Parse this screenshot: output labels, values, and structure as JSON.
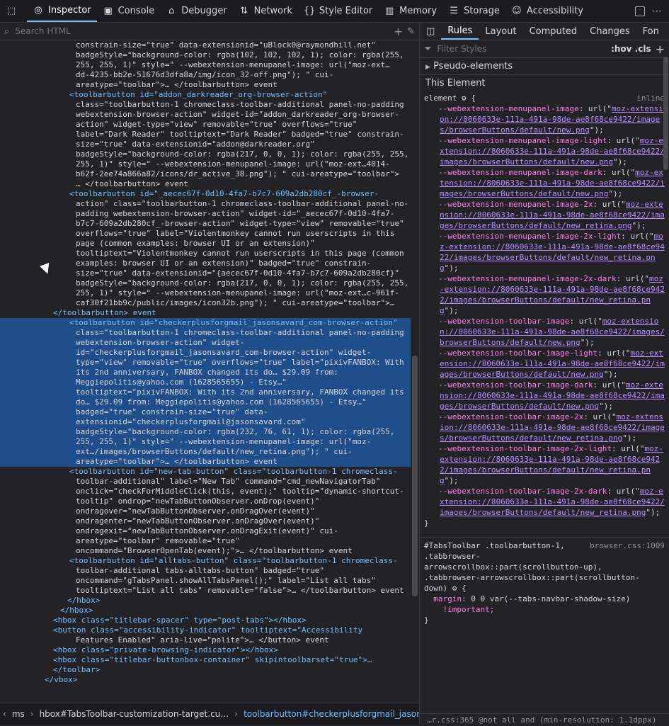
{
  "toolbar": {
    "tabs": [
      {
        "label": "Inspector",
        "icon": "inspector-icon"
      },
      {
        "label": "Console",
        "icon": "console-icon"
      },
      {
        "label": "Debugger",
        "icon": "debugger-icon"
      },
      {
        "label": "Network",
        "icon": "network-icon"
      },
      {
        "label": "Style Editor",
        "icon": "style-editor-icon"
      },
      {
        "label": "Memory",
        "icon": "memory-icon"
      },
      {
        "label": "Storage",
        "icon": "storage-icon"
      },
      {
        "label": "Accessibility",
        "icon": "accessibility-icon"
      }
    ]
  },
  "search": {
    "placeholder": "Search HTML"
  },
  "tree": {
    "lines": [
      "constrain-size=\"true\" data-extensionid=\"uBlock0@raymondhill.net\"",
      "badgeStyle=\"background-color: rgba(102, 102, 102, 1); color: rgba(255,",
      "255, 255, 1)\" style=\" --webextension-menupanel-image: url(\"moz-ext…",
      "dd-4235-bb2e-51676d3dfa8a/img/icon_32-off.png\"); \" cui-",
      "areatype=\"toolbar\">… </toolbarbutton> event",
      "<toolbarbutton id=\"addon_darkreader_org-browser-action\"",
      "class=\"toolbarbutton-1 chromeclass-toolbar-additional panel-no-padding",
      "webextension-browser-action\" widget-id=\"addon_darkreader_org-browser-",
      "action\" widget-type=\"view\" removable=\"true\" overflows=\"true\"",
      "label=\"Dark Reader\" tooltiptext=\"Dark Reader\" badged=\"true\" constrain-",
      "size=\"true\" data-extensionid=\"addon@darkreader.org\"",
      "badgeStyle=\"background-color: rgba(217, 0, 0, 1); color: rgba(255, 255,",
      "255, 1)\" style=\" --webextension-menupanel-image: url(\"moz-ext…4014-",
      "b62f-2ee74a866a82/icons/dr_active_38.png\"); \" cui-areatype=\"toolbar\">",
      "… </toolbarbutton> event",
      "<toolbarbutton id=\"_aecec67f-0d10-4fa7-b7c7-609a2db280cf_-browser-",
      "action\" class=\"toolbarbutton-1 chromeclass-toolbar-additional panel-no-",
      "padding webextension-browser-action\" widget-id=\"_aecec67f-0d10-4fa7-",
      "b7c7-609a2db280cf_-browser-action\" widget-type=\"view\" removable=\"true\"",
      "overflows=\"true\" label=\"Violentmonkey cannot run userscripts in this",
      "page (common examples: browser UI or an extension)\"",
      "tooltiptext=\"Violentmonkey cannot run userscripts in this page (common",
      "examples: browser UI or an extension)\" badged=\"true\" constrain-",
      "size=\"true\" data-extensionid=\"{aecec67f-0d10-4fa7-b7c7-609a2db280cf}\"",
      "badgeStyle=\"background-color: rgba(217, 0, 0, 1); color: rgba(255, 255,",
      "255, 1)\" style=\" --webextension-menupanel-image: url(\"moz-ext…c-961f-",
      "caf30f21bb9c/public/images/icon32b.png\"); \" cui-areatype=\"toolbar\">…",
      "</toolbarbutton> event"
    ],
    "selected_lines": [
      "<toolbarbutton id=\"checkerplusforgmail_jasonsavard_com-browser-action\"",
      "class=\"toolbarbutton-1 chromeclass-toolbar-additional panel-no-padding",
      "webextension-browser-action\" widget-",
      "id=\"checkerplusforgmail_jasonsavard_com-browser-action\" widget-",
      "type=\"view\" removable=\"true\" overflows=\"true\" label=\"pixivFANBOX: With",
      "its 2nd anniversary, FANBOX changed its do… $29.09 from:",
      "Meggiepolitis@yahoo.com (1628565655) - Etsy…\"",
      "tooltiptext=\"pixivFANBOX: With its 2nd anniversary, FANBOX changed its",
      "do… $29.09 from: Meggiepolitis@yahoo.com (1628565655) - Etsy…\"",
      "badged=\"true\" constrain-size=\"true\" data-",
      "extensionid=\"checkerplusforgmail@jasonsavard.com\"",
      "badgeStyle=\"background-color: rgba(232, 76, 61, 1); color: rgba(255,",
      "255, 255, 1)\" style=\" --webextension-menupanel-image: url(\"moz-",
      "ext…/images/browserButtons/default/new_retina.png\"); \" cui-",
      "areatype=\"toolbar\">… </toolbarbutton> event"
    ],
    "after_lines": [
      "<toolbarbutton id=\"new-tab-button\" class=\"toolbarbutton-1 chromeclass-",
      "toolbar-additional\" label=\"New Tab\" command=\"cmd_newNavigatorTab\"",
      "onclick=\"checkForMiddleClick(this, event);\" tooltip=\"dynamic-shortcut-",
      "tooltip\" ondrop=\"newTabButtonObserver.onDrop(event)\"",
      "ondragover=\"newTabButtonObserver.onDragOver(event)\"",
      "ondragenter=\"newTabButtonObserver.onDragOver(event)\"",
      "ondragexit=\"newTabButtonObserver.onDragExit(event)\" cui-",
      "areatype=\"toolbar\" removable=\"true\"",
      "oncommand=\"BrowserOpenTab(event);\">… </toolbarbutton> event",
      "<toolbarbutton id=\"alltabs-button\" class=\"toolbarbutton-1 chromeclass-",
      "toolbar-additional tabs-alltabs-button\" badged=\"true\"",
      "oncommand=\"gTabsPanel.showAllTabsPanel();\" label=\"List all tabs\"",
      "tooltiptext=\"List all tabs\" removable=\"false\">… </toolbarbutton> event",
      "</hbox>",
      "</hbox>",
      "<hbox class=\"titlebar-spacer\" type=\"post-tabs\"></hbox>",
      "<button class=\"accessibility-indicator\" tooltiptext=\"Accessibility",
      "Features Enabled\" aria-live=\"polite\">… </button> event",
      "<hbox class=\"private-browsing-indicator\"></hbox>",
      "<hbox class=\"titlebar-buttonbox-container\" skipintoolbarset=\"true\">…",
      "</toolbar>",
      "</vbox>"
    ]
  },
  "breadcrumb": {
    "items": [
      "ms",
      "hbox#TabsToolbar-customization-target.cu…",
      "toolbarbutton#checkerplusforgmail_jasons…"
    ]
  },
  "rules": {
    "tabs": [
      "Rules",
      "Layout",
      "Computed",
      "Changes",
      "Fon"
    ],
    "filter_placeholder": "Filter Styles",
    "hov_cls": ":hov .cls",
    "pseudo_elements": "Pseudo-elements",
    "this_element": "This Element",
    "element_selector": "element",
    "inline": "inline",
    "declarations": [
      {
        "prop": "--webextension-menupanel-image",
        "url": "moz-extension://8060633e-111a-491a-98de-ae8f68ce9422/images/browserButtons/default/new.png"
      },
      {
        "prop": "--webextension-menupanel-image-light",
        "url": "moz-extension://8060633e-111a-491a-98de-ae8f68ce9422/images/browserButtons/default/new.png"
      },
      {
        "prop": "--webextension-menupanel-image-dark",
        "url": "moz-extension://8060633e-111a-491a-98de-ae8f68ce9422/images/browserButtons/default/new.png"
      },
      {
        "prop": "--webextension-menupanel-image-2x",
        "url": "moz-extension://8060633e-111a-491a-98de-ae8f68ce9422/images/browserButtons/default/new_retina.png"
      },
      {
        "prop": "--webextension-menupanel-image-2x-light",
        "url": "moz-extension://8060633e-111a-491a-98de-ae8f68ce9422/images/browserButtons/default/new_retina.png"
      },
      {
        "prop": "--webextension-menupanel-image-2x-dark",
        "url": "moz-extension://8060633e-111a-491a-98de-ae8f68ce9422/images/browserButtons/default/new_retina.png"
      },
      {
        "prop": "--webextension-toolbar-image",
        "url": "moz-extension://8060633e-111a-491a-98de-ae8f68ce9422/images/browserButtons/default/new.png"
      },
      {
        "prop": "--webextension-toolbar-image-light",
        "url": "moz-extension://8060633e-111a-491a-98de-ae8f68ce9422/images/browserButtons/default/new.png"
      },
      {
        "prop": "--webextension-toolbar-image-dark",
        "url": "moz-extension://8060633e-111a-491a-98de-ae8f68ce9422/images/browserButtons/default/new.png"
      },
      {
        "prop": "--webextension-toolbar-image-2x",
        "url": "moz-extension://8060633e-111a-491a-98de-ae8f68ce9422/images/browserButtons/default/new_retina.png"
      },
      {
        "prop": "--webextension-toolbar-image-2x-light",
        "url": "moz-extension://8060633e-111a-491a-98de-ae8f68ce9422/images/browserButtons/default/new_retina.png"
      },
      {
        "prop": "--webextension-toolbar-image-2x-dark",
        "url": "moz-extension://8060633e-111a-491a-98de-ae8f68ce9422/images/browserButtons/default/new_retina.png"
      }
    ],
    "rule2": {
      "selector_lines": [
        "#TabsToolbar .toolbarbutton-1,",
        ".tabbrowser-",
        "arrowscrollbox::part(scrollbutton-up),",
        ".tabbrowser-arrowscrollbox::part(scrollbutton-",
        "down)"
      ],
      "source": "browser.css:1009",
      "prop": "margin",
      "value": "0 0 var(--tabs-navbar-shadow-size)",
      "important": "!important;"
    },
    "rule3_source": "…r.css:365 @not all and (min-resolution: 1.1dppx)"
  },
  "colors": {
    "accent": "#75bfff",
    "selection": "#204e8a",
    "background": "#232327"
  }
}
